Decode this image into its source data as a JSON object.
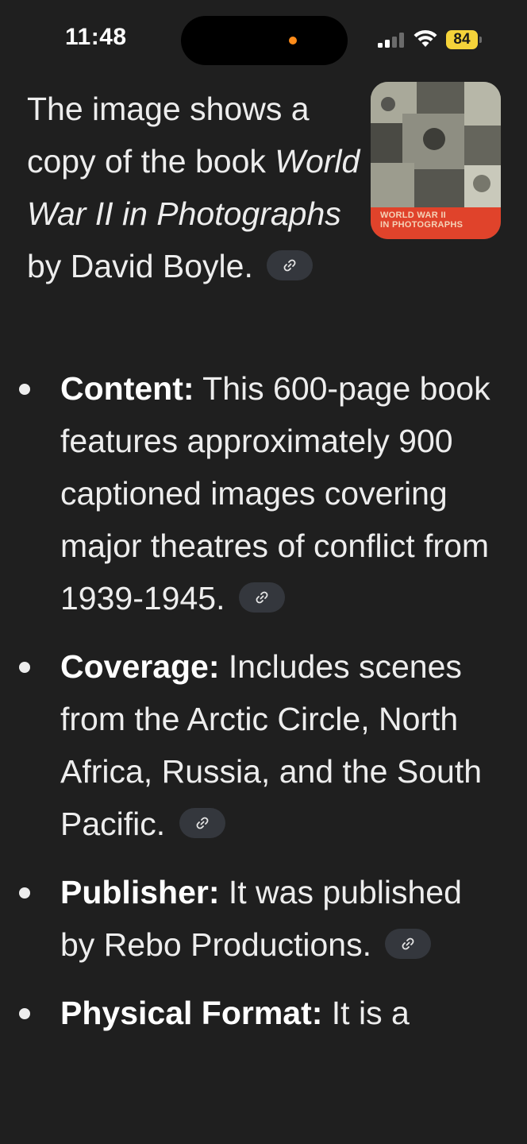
{
  "status_bar": {
    "time": "11:48",
    "battery": "84",
    "colors": {
      "battery_fill": "#f5d33a",
      "signal_active": "#ffffff",
      "signal_inactive": "#6b6b6b",
      "camera_dot": "#ff8c1a"
    }
  },
  "response": {
    "intro": {
      "text_before": "The image shows a copy of the book ",
      "book_title": "World War II in Photographs",
      "text_after": " by David Boyle."
    },
    "thumbnail": {
      "cover_text_line1": "WORLD WAR II",
      "cover_text_line2": "IN PHOTOGRAPHS"
    },
    "bullets": [
      {
        "label": "Content:",
        "text": " This 600-page book features approximately 900 captioned images covering major theatres of conflict from 1939-1945."
      },
      {
        "label": "Coverage:",
        "text": " Includes scenes from the Arctic Circle, North Africa, Russia, and the South Pacific."
      },
      {
        "label": "Publisher:",
        "text": " It was published by Rebo Productions."
      },
      {
        "label": "Physical Format:",
        "text": " It is a"
      }
    ],
    "cite_icon": "link-icon"
  }
}
